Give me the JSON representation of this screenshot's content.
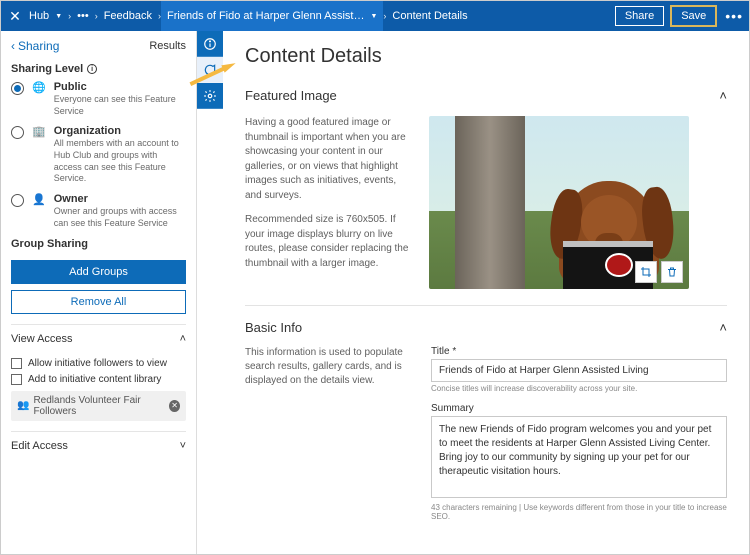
{
  "topbar": {
    "hub": "Hub",
    "ellipsis": "•••",
    "feedback": "Feedback",
    "item_name": "Friends of Fido at Harper Glenn Assist…",
    "content_details": "Content Details",
    "share": "Share",
    "save": "Save"
  },
  "sidebar": {
    "back": "Sharing",
    "results": "Results",
    "level_label": "Sharing Level",
    "levels": [
      {
        "title": "Public",
        "desc": "Everyone can see this Feature Service"
      },
      {
        "title": "Organization",
        "desc": "All members with an account to Hub Club and groups with access can see this Feature Service."
      },
      {
        "title": "Owner",
        "desc": "Owner and groups with access can see this Feature Service"
      }
    ],
    "group_sharing": "Group Sharing",
    "add_groups": "Add Groups",
    "remove_all": "Remove All",
    "view_access": "View Access",
    "allow_followers": "Allow initiative followers to view",
    "add_library": "Add to initiative content library",
    "chip": "Redlands Volunteer Fair Followers",
    "edit_access": "Edit Access"
  },
  "content": {
    "title": "Content Details",
    "featured": {
      "head": "Featured Image",
      "p1": "Having a good featured image or thumbnail is important when you are showcasing your content in our galleries, or on views that highlight images such as initiatives, events, and surveys.",
      "p2": "Recommended size is 760x505. If your image displays blurry on live routes, please consider replacing the thumbnail with a larger image."
    },
    "basic": {
      "head": "Basic Info",
      "desc": "This information is used to populate search results, gallery cards, and is displayed on the details view.",
      "title_label": "Title",
      "title_value": "Friends of Fido at Harper Glenn Assisted Living",
      "title_hint": "Concise titles will increase discoverability across your site.",
      "summary_label": "Summary",
      "summary_value": "The new Friends of Fido program welcomes you and your pet to meet the residents at Harper Glenn Assisted Living Center. Bring joy to our community by signing up your pet for our therapeutic visitation hours.",
      "summary_hint": "43 characters remaining | Use keywords different from those in your title to increase SEO."
    }
  }
}
